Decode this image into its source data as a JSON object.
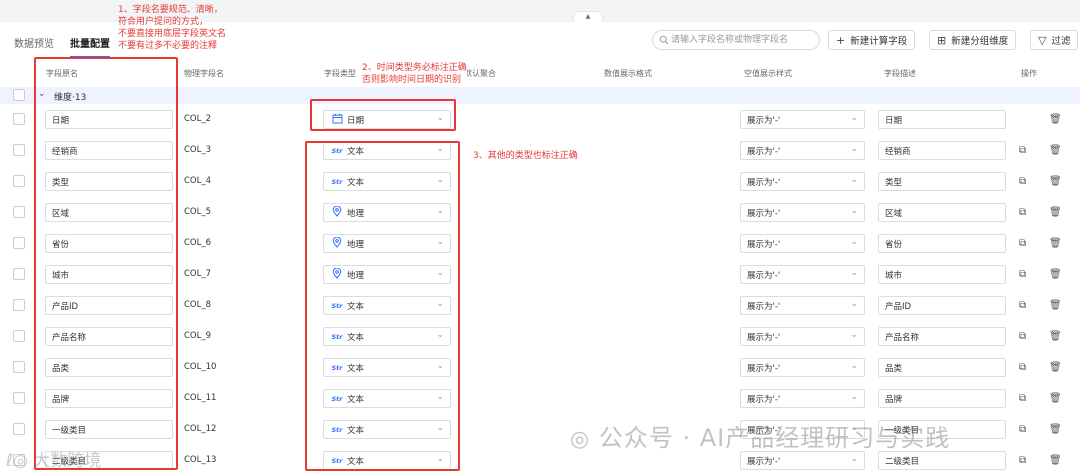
{
  "tabs": [
    "数据预览",
    "批量配置"
  ],
  "search": {
    "placeholder": "请输入字段名称或物理字段名"
  },
  "toolbar": {
    "new_calc_field": "新建计算字段",
    "new_group_dim": "新建分组维度",
    "filter": "过滤"
  },
  "columns": [
    "字段原名",
    "物理字段名",
    "字段类型",
    "默认聚合",
    "数值展示格式",
    "空值展示样式",
    "字段描述",
    "操作"
  ],
  "group": {
    "label": "维度·13"
  },
  "rows": [
    {
      "name": "日期",
      "phys": "COL_2",
      "type": "日期",
      "icon": "calendar",
      "empty": "展示为'-'",
      "desc": "日期"
    },
    {
      "name": "经销商",
      "phys": "COL_3",
      "type": "文本",
      "icon": "str",
      "empty": "展示为'-'",
      "desc": "经销商"
    },
    {
      "name": "类型",
      "phys": "COL_4",
      "type": "文本",
      "icon": "str",
      "empty": "展示为'-'",
      "desc": "类型"
    },
    {
      "name": "区域",
      "phys": "COL_5",
      "type": "地理",
      "icon": "geo",
      "empty": "展示为'-'",
      "desc": "区域"
    },
    {
      "name": "省份",
      "phys": "COL_6",
      "type": "地理",
      "icon": "geo",
      "empty": "展示为'-'",
      "desc": "省份"
    },
    {
      "name": "城市",
      "phys": "COL_7",
      "type": "地理",
      "icon": "geo",
      "empty": "展示为'-'",
      "desc": "城市"
    },
    {
      "name": "产品ID",
      "phys": "COL_8",
      "type": "文本",
      "icon": "str",
      "empty": "展示为'-'",
      "desc": "产品ID"
    },
    {
      "name": "产品名称",
      "phys": "COL_9",
      "type": "文本",
      "icon": "str",
      "empty": "展示为'-'",
      "desc": "产品名称"
    },
    {
      "name": "品类",
      "phys": "COL_10",
      "type": "文本",
      "icon": "str",
      "empty": "展示为'-'",
      "desc": "品类"
    },
    {
      "name": "品牌",
      "phys": "COL_11",
      "type": "文本",
      "icon": "str",
      "empty": "展示为'-'",
      "desc": "品牌"
    },
    {
      "name": "一级类目",
      "phys": "COL_12",
      "type": "文本",
      "icon": "str",
      "empty": "展示为'-'",
      "desc": "一级类目"
    },
    {
      "name": "二级类目",
      "phys": "COL_13",
      "type": "文本",
      "icon": "str",
      "empty": "展示为'-'",
      "desc": "二级类目"
    }
  ],
  "str_icon_text": "Str",
  "annotations": {
    "note1": [
      "1、字段名要规范、清晰，",
      "符合用户提问的方式，",
      "不要直接用底层字段英文名",
      "不要有过多不必要的注释"
    ],
    "note2": [
      "2、时间类型务必标注正确",
      "否则影响时间日期的识别"
    ],
    "note3": "3、其他的类型也标注正确"
  },
  "watermarks": {
    "main": "公众号 · AI产品经理研习与实践",
    "corner": "大数跨境"
  },
  "colors": {
    "accent": "#3370ff",
    "annotation": "#e53935",
    "group_bg": "#eef3ff"
  }
}
